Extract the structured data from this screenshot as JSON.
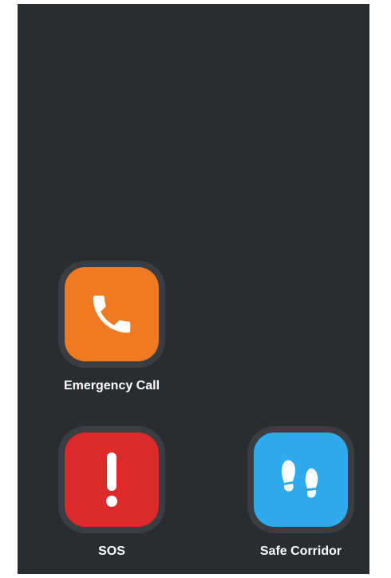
{
  "colors": {
    "screen_background": "#2a2d30",
    "icon_ring": "#3a3d41",
    "label_text": "#ffffff"
  },
  "apps": [
    {
      "label": "Emergency Call",
      "icon": "phone-icon",
      "color": "#f07a22"
    },
    {
      "label": "SOS",
      "icon": "exclamation-icon",
      "color": "#dc2a2a"
    },
    {
      "label": "Safe Corridor",
      "icon": "footsteps-icon",
      "color": "#2eaaef"
    }
  ]
}
